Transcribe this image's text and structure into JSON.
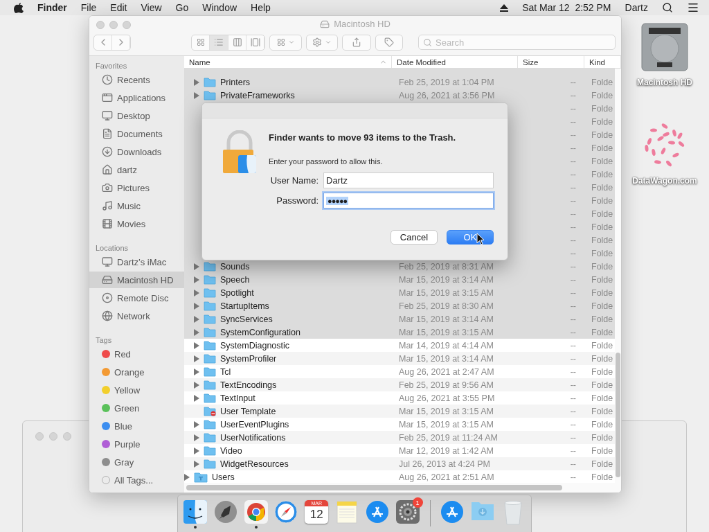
{
  "menu_bar": {
    "app": "Finder",
    "menus": [
      "File",
      "Edit",
      "View",
      "Go",
      "Window",
      "Help"
    ],
    "clock": "Sat Mar 12  2:52 PM",
    "user": "Dartz"
  },
  "window": {
    "title": "Macintosh HD",
    "search": {
      "placeholder": "Search"
    }
  },
  "sidebar": {
    "sections": [
      {
        "title": "Favorites",
        "items": [
          {
            "label": "Recents",
            "selected": false
          },
          {
            "label": "Applications",
            "selected": false
          },
          {
            "label": "Desktop",
            "selected": false
          },
          {
            "label": "Documents",
            "selected": false
          },
          {
            "label": "Downloads",
            "selected": false
          },
          {
            "label": "dartz",
            "selected": false
          },
          {
            "label": "Pictures",
            "selected": false
          },
          {
            "label": "Music",
            "selected": false
          },
          {
            "label": "Movies",
            "selected": false
          }
        ]
      },
      {
        "title": "Locations",
        "items": [
          {
            "label": "Dartz’s iMac",
            "selected": false
          },
          {
            "label": "Macintosh HD",
            "selected": true
          },
          {
            "label": "Remote Disc",
            "selected": false
          },
          {
            "label": "Network",
            "selected": false
          }
        ]
      },
      {
        "title": "Tags",
        "items": [
          {
            "label": "Red",
            "color": "#ef4b4b",
            "selected": false
          },
          {
            "label": "Orange",
            "color": "#f39a33",
            "selected": false
          },
          {
            "label": "Yellow",
            "color": "#f2cf2c",
            "selected": false
          },
          {
            "label": "Green",
            "color": "#5ac15a",
            "selected": false
          },
          {
            "label": "Blue",
            "color": "#3c8ef0",
            "selected": false
          },
          {
            "label": "Purple",
            "color": "#b05ed6",
            "selected": false
          },
          {
            "label": "Gray",
            "color": "#8e8e8e",
            "selected": false
          },
          {
            "label": "All Tags...",
            "selected": false
          }
        ]
      }
    ]
  },
  "table": {
    "columns": [
      "Name",
      "Date Modified",
      "Size",
      "Kind"
    ],
    "rows": [
      {
        "children": [
          {
            "kind": "partial",
            "selected": true
          },
          {
            "kind": "folder",
            "name": "Printers",
            "date": "Feb 25, 2019 at 1:04 PM",
            "size": "--",
            "type": "Folde",
            "selected": true
          },
          {
            "kind": "folder",
            "name": "PrivateFrameworks",
            "date": "Aug 26, 2021 at 3:56 PM",
            "size": "--",
            "type": "Folde",
            "selected": true
          },
          {
            "kind": "covered",
            "size": "--",
            "type": "Folde",
            "selected": true
          },
          {
            "kind": "covered",
            "size": "--",
            "type": "Folde",
            "selected": true
          },
          {
            "kind": "covered",
            "size": "--",
            "type": "Folde",
            "selected": true
          },
          {
            "kind": "covered",
            "size": "--",
            "type": "Folde",
            "selected": true
          },
          {
            "kind": "covered",
            "size": "--",
            "type": "Folde",
            "selected": true
          },
          {
            "kind": "covered",
            "size": "--",
            "type": "Folde",
            "selected": true
          },
          {
            "kind": "covered",
            "size": "--",
            "type": "Folde",
            "selected": true
          },
          {
            "kind": "covered",
            "size": "--",
            "type": "Folde",
            "selected": true
          },
          {
            "kind": "covered",
            "size": "--",
            "type": "Folde",
            "selected": true
          },
          {
            "kind": "covered",
            "size": "--",
            "type": "Folde",
            "selected": true
          },
          {
            "kind": "covered",
            "size": "--",
            "type": "Folde",
            "selected": true
          },
          {
            "kind": "covered",
            "size": "--",
            "type": "Folde",
            "selected": true
          },
          {
            "kind": "folder",
            "name": "Sounds",
            "date": "Feb 25, 2019 at 8:31 AM",
            "size": "--",
            "type": "Folde",
            "selected": true
          },
          {
            "kind": "folder",
            "name": "Speech",
            "date": "Mar 15, 2019 at 3:14 AM",
            "size": "--",
            "type": "Folde",
            "selected": true
          },
          {
            "kind": "folder",
            "name": "Spotlight",
            "date": "Mar 15, 2019 at 3:15 AM",
            "size": "--",
            "type": "Folde",
            "selected": true
          },
          {
            "kind": "folder",
            "name": "StartupItems",
            "date": "Feb 25, 2019 at 8:30 AM",
            "size": "--",
            "type": "Folde",
            "selected": true
          },
          {
            "kind": "folder",
            "name": "SyncServices",
            "date": "Mar 15, 2019 at 3:14 AM",
            "size": "--",
            "type": "Folde",
            "selected": true
          },
          {
            "kind": "folder",
            "name": "SystemConfiguration",
            "date": "Mar 15, 2019 at 3:15 AM",
            "size": "--",
            "type": "Folde",
            "selected": true
          },
          {
            "kind": "folder",
            "name": "SystemDiagnostic",
            "date": "Mar 14, 2019 at 4:14 AM",
            "size": "--",
            "type": "Folde",
            "selected": false
          },
          {
            "kind": "folder",
            "name": "SystemProfiler",
            "date": "Mar 15, 2019 at 3:14 AM",
            "size": "--",
            "type": "Folde",
            "selected": false
          },
          {
            "kind": "folder",
            "name": "Tcl",
            "date": "Aug 26, 2021 at 2:47 AM",
            "size": "--",
            "type": "Folde",
            "selected": false
          },
          {
            "kind": "folder",
            "name": "TextEncodings",
            "date": "Feb 25, 2019 at 9:56 AM",
            "size": "--",
            "type": "Folde",
            "selected": false
          },
          {
            "kind": "folder",
            "name": "TextInput",
            "date": "Aug 26, 2021 at 3:55 PM",
            "size": "--",
            "type": "Folde",
            "selected": false
          },
          {
            "kind": "locked",
            "name": "User Template",
            "date": "Mar 15, 2019 at 3:15 AM",
            "size": "--",
            "type": "Folde",
            "selected": false
          },
          {
            "kind": "folder",
            "name": "UserEventPlugins",
            "date": "Mar 15, 2019 at 3:15 AM",
            "size": "--",
            "type": "Folde",
            "selected": false
          },
          {
            "kind": "folder",
            "name": "UserNotifications",
            "date": "Feb 25, 2019 at 11:24 AM",
            "size": "--",
            "type": "Folde",
            "selected": false
          },
          {
            "kind": "folder",
            "name": "Video",
            "date": "Mar 12, 2019 at 1:42 AM",
            "size": "--",
            "type": "Folde",
            "selected": false
          },
          {
            "kind": "folder",
            "name": "WidgetResources",
            "date": "Jul 26, 2013 at 4:24 PM",
            "size": "--",
            "type": "Folde",
            "selected": false
          }
        ]
      },
      {
        "kind": "user",
        "name": "Users",
        "date": "Aug 26, 2021 at 2:51 AM",
        "size": "--",
        "type": "Folde",
        "selected": false
      }
    ]
  },
  "dialog": {
    "title": "Finder wants to move 93 items to the Trash.",
    "message": "Enter your password to allow this.",
    "user_label": "User Name:",
    "user_value": "Dartz",
    "password_label": "Password:",
    "password_value": "●●●●●",
    "buttons": [
      "Cancel",
      "OK"
    ]
  },
  "desktop_icons": [
    "Macintosh HD",
    "DataWagon.com"
  ],
  "dock": {
    "items": [
      {
        "running": true
      },
      {
        "running": false
      },
      {
        "running": true
      },
      {
        "running": false
      },
      {
        "running": false,
        "month": "MAR",
        "day": "12"
      },
      {
        "running": false
      },
      {
        "running": false
      },
      {
        "running": false,
        "badge": "1"
      },
      {
        "running": false
      },
      {
        "running": false
      },
      {
        "running": false
      }
    ]
  }
}
